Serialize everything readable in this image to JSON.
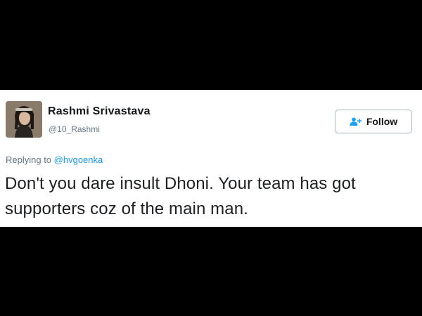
{
  "tweet": {
    "author": {
      "name": "Rashmi Srivastava",
      "handle": "@10_Rashmi",
      "avatar": "profile-photo"
    },
    "follow_button": {
      "label": "Follow",
      "icon": "add-user-icon"
    },
    "reply": {
      "prefix": "Replying to",
      "mention": "@hvgoenka"
    },
    "text": "Don't you dare insult Dhoni. Your team has got supporters coz of the main man."
  },
  "colors": {
    "background": "#000000",
    "card": "#ffffff",
    "name": "#14171a",
    "secondary": "#657786",
    "link": "#1b95e0",
    "follow_icon": "#1da1f2"
  }
}
